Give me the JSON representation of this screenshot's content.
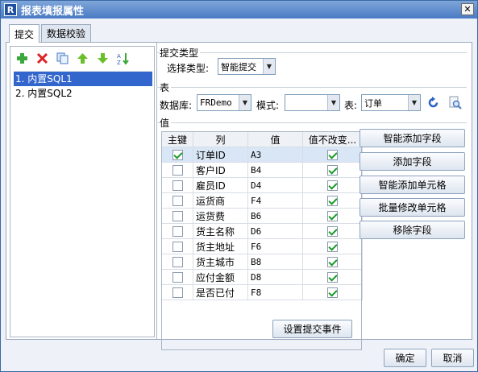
{
  "window": {
    "title": "报表填报属性",
    "icon_letter": "R",
    "close_glyph": "✕"
  },
  "tabs": [
    {
      "label": "提交",
      "active": true
    },
    {
      "label": "数据校验",
      "active": false
    }
  ],
  "toolbar": {
    "icons": [
      "add-icon",
      "delete-icon",
      "copy-icon",
      "move-up-icon",
      "move-down-icon",
      "sort-icon"
    ]
  },
  "submit_list": [
    {
      "label": "1. 内置SQL1",
      "selected": true
    },
    {
      "label": "2. 内置SQL2",
      "selected": false
    }
  ],
  "submit_type": {
    "group_label": "提交类型",
    "label": "选择类型:",
    "value": "智能提交"
  },
  "table_section": {
    "group_label": "表",
    "db_label": "数据库:",
    "db_value": "FRDemo",
    "schema_label": "模式:",
    "schema_value": "",
    "table_label": "表:",
    "table_value": "订单"
  },
  "values_section": {
    "group_label": "值",
    "columns": [
      "主键",
      "列",
      "值",
      "值不改变..."
    ],
    "rows": [
      {
        "key": true,
        "column": "订单ID",
        "value": "A3",
        "unchanged": true
      },
      {
        "key": false,
        "column": "客户ID",
        "value": "B4",
        "unchanged": true
      },
      {
        "key": false,
        "column": "雇员ID",
        "value": "D4",
        "unchanged": true
      },
      {
        "key": false,
        "column": "运货商",
        "value": "F4",
        "unchanged": true
      },
      {
        "key": false,
        "column": "运货费",
        "value": "B6",
        "unchanged": true
      },
      {
        "key": false,
        "column": "货主名称",
        "value": "D6",
        "unchanged": true
      },
      {
        "key": false,
        "column": "货主地址",
        "value": "F6",
        "unchanged": true
      },
      {
        "key": false,
        "column": "货主城市",
        "value": "B8",
        "unchanged": true
      },
      {
        "key": false,
        "column": "应付金额",
        "value": "D8",
        "unchanged": true
      },
      {
        "key": false,
        "column": "是否已付",
        "value": "F8",
        "unchanged": true
      }
    ]
  },
  "side_buttons": [
    "智能添加字段",
    "添加字段",
    "智能添加单元格",
    "批量修改单元格",
    "移除字段"
  ],
  "event_button": "设置提交事件",
  "footer": {
    "ok": "确定",
    "cancel": "取消"
  },
  "colors": {
    "title_bar": "#4a7ac4",
    "selection": "#3366cc",
    "check": "#1a9a28"
  }
}
